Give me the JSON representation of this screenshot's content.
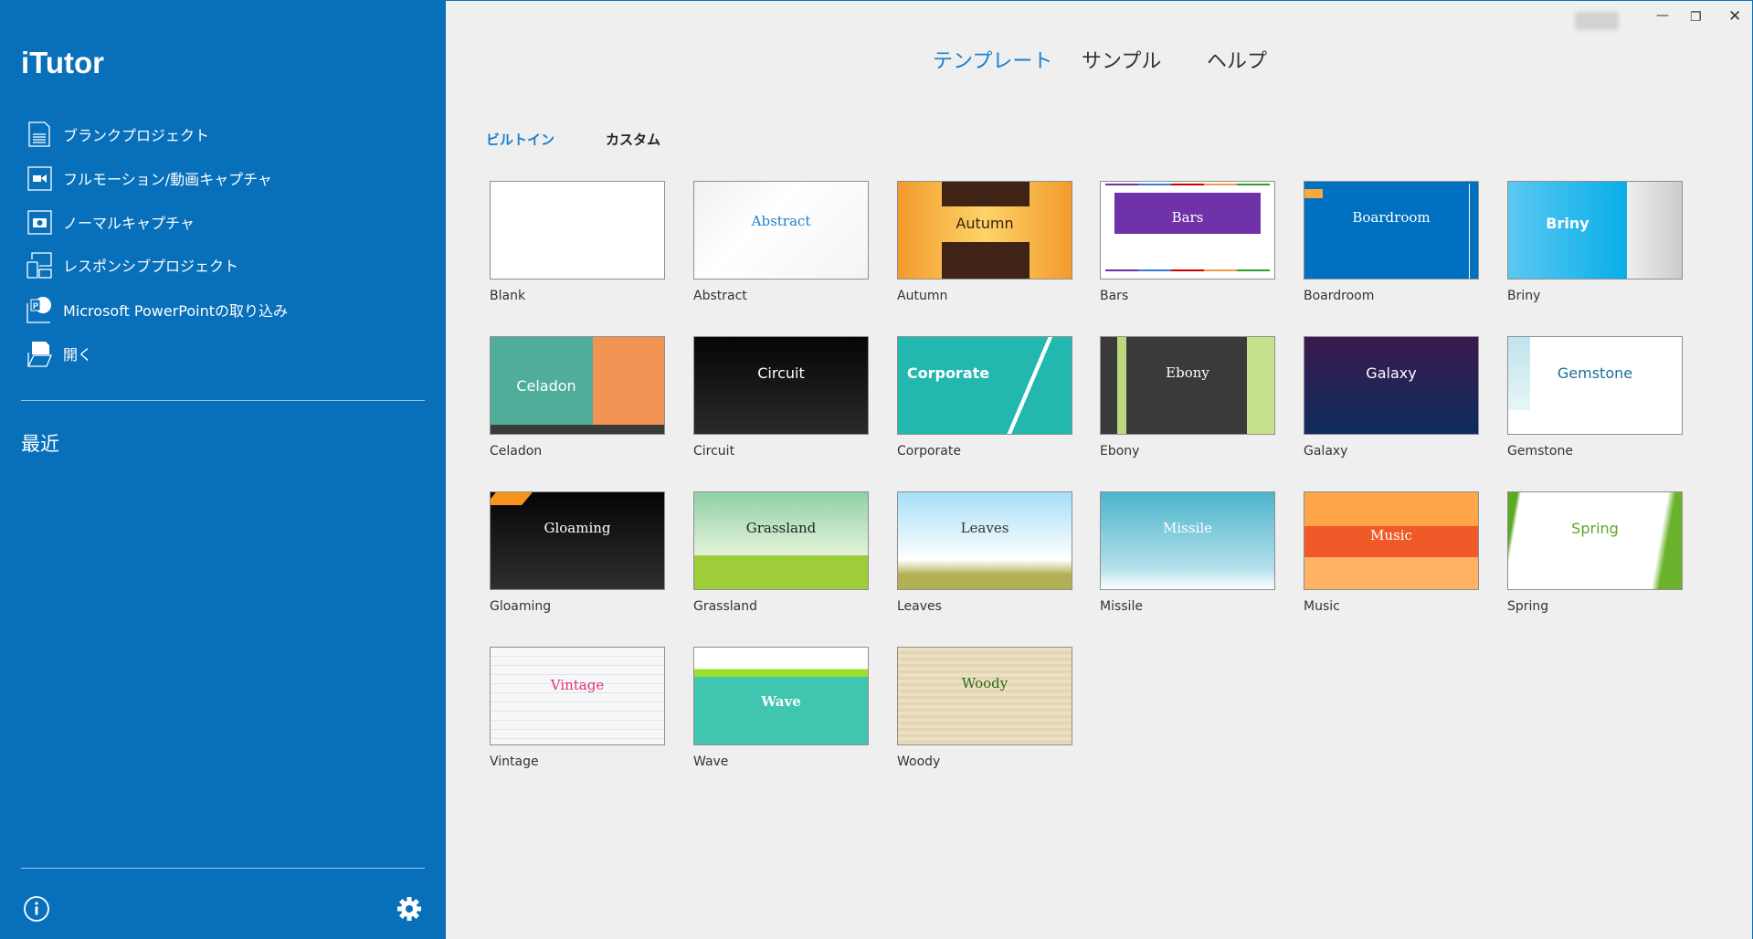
{
  "app": {
    "title": "iTutor"
  },
  "sidebar": {
    "items": [
      {
        "label": "ブランクプロジェクト",
        "icon": "document-icon"
      },
      {
        "label": "フルモーション/動画キャプチャ",
        "icon": "video-camera-icon"
      },
      {
        "label": "ノーマルキャプチャ",
        "icon": "camera-icon"
      },
      {
        "label": "レスポンシブプロジェクト",
        "icon": "responsive-devices-icon"
      },
      {
        "label": "Microsoft PowerPointの取り込み",
        "icon": "powerpoint-icon"
      },
      {
        "label": "開く",
        "icon": "open-folder-icon"
      }
    ],
    "recent_label": "最近"
  },
  "header": {
    "tabs": [
      {
        "label": "テンプレート",
        "active": true
      },
      {
        "label": "サンプル"
      },
      {
        "label": "ヘルプ"
      }
    ]
  },
  "subtabs": [
    {
      "label": "ビルトイン",
      "active": true
    },
    {
      "label": "カスタム"
    }
  ],
  "colors": {
    "sidebar": "#0870ba",
    "accent": "#1a7fcf",
    "background": "#efefef"
  },
  "templates": [
    {
      "name": "Blank",
      "title": ""
    },
    {
      "name": "Abstract",
      "title": "Abstract"
    },
    {
      "name": "Autumn",
      "title": "Autumn"
    },
    {
      "name": "Bars",
      "title": "Bars"
    },
    {
      "name": "Boardroom",
      "title": "Boardroom"
    },
    {
      "name": "Briny",
      "title": "Briny"
    },
    {
      "name": "Celadon",
      "title": "Celadon"
    },
    {
      "name": "Circuit",
      "title": "Circuit"
    },
    {
      "name": "Corporate",
      "title": "Corporate"
    },
    {
      "name": "Ebony",
      "title": "Ebony"
    },
    {
      "name": "Galaxy",
      "title": "Galaxy"
    },
    {
      "name": "Gemstone",
      "title": "Gemstone"
    },
    {
      "name": "Gloaming",
      "title": "Gloaming"
    },
    {
      "name": "Grassland",
      "title": "Grassland"
    },
    {
      "name": "Leaves",
      "title": "Leaves"
    },
    {
      "name": "Missile",
      "title": "Missile"
    },
    {
      "name": "Music",
      "title": "Music"
    },
    {
      "name": "Spring",
      "title": "Spring"
    },
    {
      "name": "Vintage",
      "title": "Vintage"
    },
    {
      "name": "Wave",
      "title": "Wave"
    },
    {
      "name": "Woody",
      "title": "Woody"
    }
  ]
}
